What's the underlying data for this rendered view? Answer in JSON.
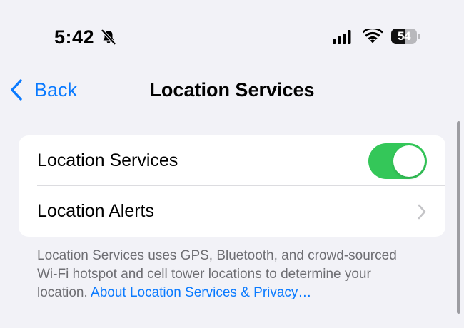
{
  "status_bar": {
    "time": "5:42",
    "silent_icon": "bell-slash-icon",
    "cellular_icon": "cellular-signal-icon",
    "wifi_icon": "wifi-icon",
    "battery_level": "54",
    "battery_fraction": 0.54
  },
  "nav": {
    "back_label": "Back",
    "back_icon": "chevron-left-icon",
    "title": "Location Services"
  },
  "settings": {
    "rows": [
      {
        "label": "Location Services",
        "control": "toggle",
        "enabled": true
      },
      {
        "label": "Location Alerts",
        "control": "disclosure-chevron"
      }
    ]
  },
  "footer": {
    "text": "Location Services uses GPS, Bluetooth, and crowd-sourced Wi-Fi hotspot and cell tower locations to determine your location.",
    "link": "About Location Services & Privacy…"
  },
  "colors": {
    "accent": "#0a7aff",
    "toggle_on": "#34c759",
    "background": "#f2f2f7",
    "footer_text": "#6e6e73"
  }
}
